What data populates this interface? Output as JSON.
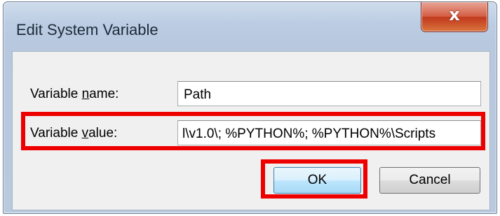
{
  "window": {
    "title": "Edit System Variable",
    "close_glyph": "x"
  },
  "form": {
    "name_label_prefix": "Variable ",
    "name_label_accel": "n",
    "name_label_suffix": "ame:",
    "name_value": "Path",
    "value_label_prefix": "Variable ",
    "value_label_accel": "v",
    "value_label_suffix": "alue:",
    "value_value": "l\\v1.0\\; %PYTHON%; %PYTHON%\\Scripts"
  },
  "buttons": {
    "ok_label": "OK",
    "cancel_label": "Cancel"
  },
  "colors": {
    "highlight": "#ee0000",
    "title_bar": "#bccde3",
    "close_button": "#c2391d",
    "client_bg": "#f0f0f0"
  },
  "icons": {
    "close": "close-icon"
  }
}
